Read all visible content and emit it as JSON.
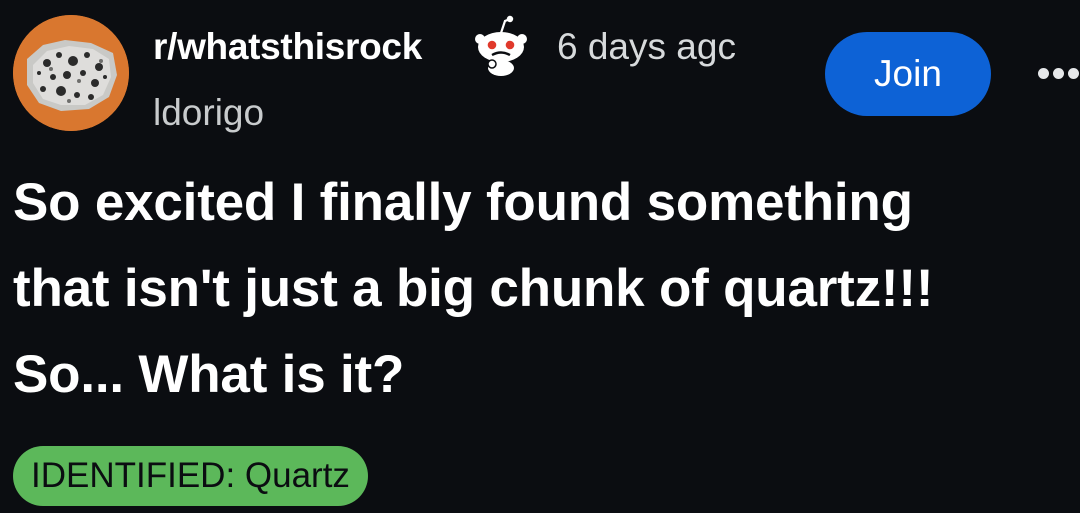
{
  "post": {
    "subreddit": "r/whatsthisrock",
    "time": "6 days agc",
    "author": "ldorigo",
    "join_label": "Join",
    "title_lines": [
      "So excited I finally found something",
      "that isn't just a big chunk of quartz!!!",
      "So... What is it?"
    ],
    "flair": "IDENTIFIED: Quartz"
  },
  "icons": {
    "avatar": "rock-avatar-icon",
    "awarded": "snoo-thinking-icon",
    "more": "more-options-icon"
  },
  "colors": {
    "background": "#0b0d11",
    "join_button": "#0d62d6",
    "flair": "#5cb85a",
    "avatar_ring": "#d9772f",
    "snoo_eye": "#e0392b"
  }
}
